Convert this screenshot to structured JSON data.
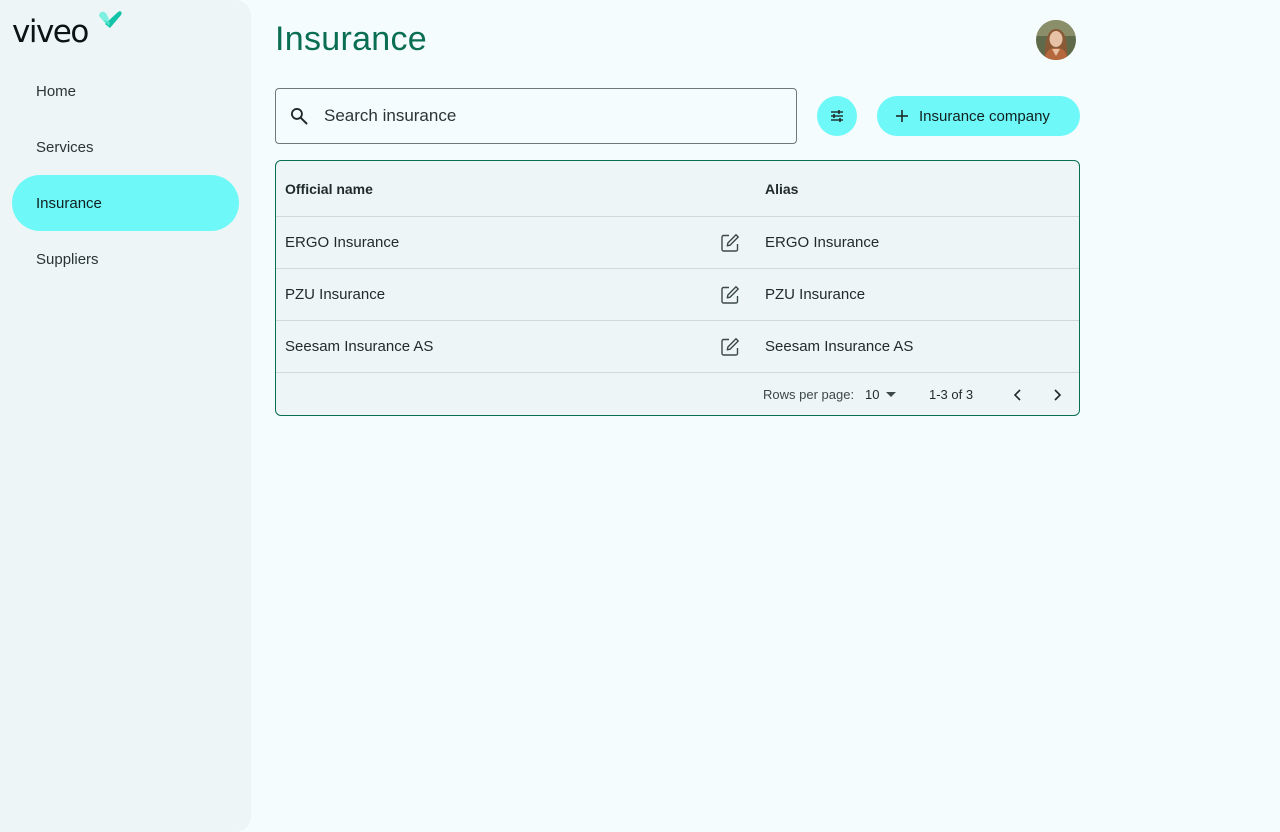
{
  "brand": {
    "name": "viveo",
    "accent": "#6ff8f8",
    "primary": "#0a6e52"
  },
  "sidebar": {
    "items": [
      {
        "label": "Home",
        "active": false
      },
      {
        "label": "Services",
        "active": false
      },
      {
        "label": "Insurance",
        "active": true
      },
      {
        "label": "Suppliers",
        "active": false
      }
    ]
  },
  "page": {
    "title": "Insurance"
  },
  "search": {
    "placeholder": "Search insurance",
    "value": ""
  },
  "actions": {
    "filter_icon": "tune-icon",
    "add_label": "Insurance company"
  },
  "table": {
    "columns": [
      "Official name",
      "Alias"
    ],
    "rows": [
      {
        "name": "ERGO Insurance",
        "alias": "ERGO Insurance"
      },
      {
        "name": "PZU Insurance",
        "alias": "PZU Insurance"
      },
      {
        "name": "Seesam Insurance AS",
        "alias": "Seesam Insurance AS"
      }
    ],
    "pagination": {
      "rows_per_page_label": "Rows per page:",
      "rows_per_page": "10",
      "range": "1-3 of 3"
    }
  }
}
